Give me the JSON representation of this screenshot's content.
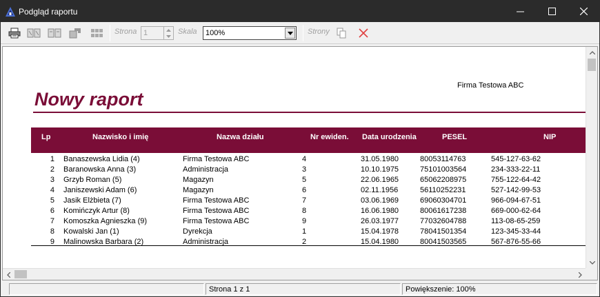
{
  "window": {
    "title": "Podgląd raportu"
  },
  "toolbar": {
    "page_label": "Strona",
    "page_value": "1",
    "scale_label": "Skala",
    "scale_value": "100%",
    "pages_label": "Strony"
  },
  "report": {
    "company": "Firma Testowa ABC",
    "title": "Nowy raport",
    "columns": [
      "Lp",
      "Nazwisko i imię",
      "Nazwa działu",
      "Nr ewiden.",
      "Data urodzenia",
      "PESEL",
      "NIP"
    ],
    "rows": [
      [
        "1",
        "Banaszewska Lidia (4)",
        "Firma Testowa ABC",
        "4",
        "31.05.1980",
        "80053114763",
        "545-127-63-62"
      ],
      [
        "2",
        "Baranowska Anna (3)",
        "Administracja",
        "3",
        "10.10.1975",
        "75101003564",
        "234-333-22-11"
      ],
      [
        "3",
        "Grzyb Roman (5)",
        "Magazyn",
        "5",
        "22.06.1965",
        "65062208975",
        "755-122-64-42"
      ],
      [
        "4",
        "Janiszewski Adam (6)",
        "Magazyn",
        "6",
        "02.11.1956",
        "56110252231",
        "527-142-99-53"
      ],
      [
        "5",
        "Jasik Elżbieta (7)",
        "Firma Testowa ABC",
        "7",
        "03.06.1969",
        "69060304701",
        "966-094-67-51"
      ],
      [
        "6",
        "Komińczyk  Artur (8)",
        "Firma Testowa ABC",
        "8",
        "16.06.1980",
        "80061617238",
        "669-000-62-64"
      ],
      [
        "7",
        "Komoszka Agnieszka (9)",
        "Firma Testowa ABC",
        "9",
        "26.03.1977",
        "77032604788",
        "113-08-65-259"
      ],
      [
        "8",
        "Kowalski Jan (1)",
        "Dyrekcja",
        "1",
        "15.04.1978",
        "78041501354",
        "123-345-33-44"
      ],
      [
        "9",
        "Malinowska Barbara (2)",
        "Administracja",
        "2",
        "15.04.1980",
        "80041503565",
        "567-876-55-66"
      ]
    ]
  },
  "status": {
    "page_info": "Strona 1  z 1",
    "zoom_info": "Powiększenie: 100%"
  },
  "colors": {
    "accent": "#7a0d37",
    "titlebar": "#2b2b2b",
    "close": "#e04040"
  }
}
